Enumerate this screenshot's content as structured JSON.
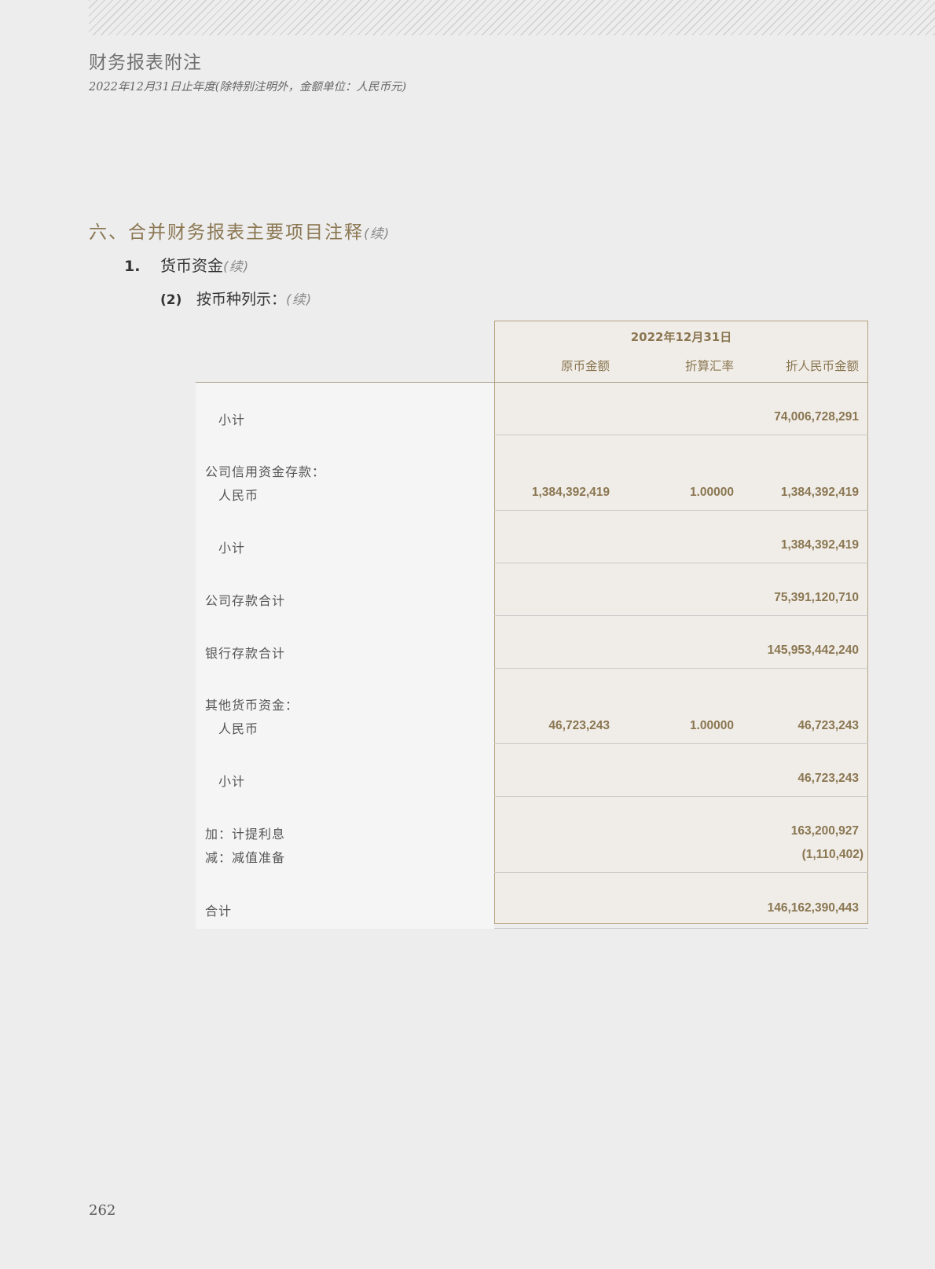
{
  "header": {
    "title": "财务报表附注",
    "subtitle": "2022年12月31日止年度(除特别注明外，金额单位：人民币元)"
  },
  "section": {
    "title": "六、合并财务报表主要项目注释",
    "cont": "(续)"
  },
  "subsection1": {
    "num": "1.",
    "title": "货币资金",
    "cont": "(续)"
  },
  "subsection2": {
    "num": "(2)",
    "title": "按币种列示：",
    "cont": "(续)"
  },
  "table": {
    "date_header": "2022年12月31日",
    "col_original": "原币金额",
    "col_rate": "折算汇率",
    "col_rmb": "折人民币金额",
    "rows": {
      "subtotal1": {
        "label": "小计",
        "rmb": "74,006,728,291"
      },
      "credit_heading": "公司信用资金存款：",
      "credit_rmb": {
        "label": "人民币",
        "orig": "1,384,392,419",
        "rate": "1.00000",
        "rmb": "1,384,392,419"
      },
      "subtotal2": {
        "label": "小计",
        "rmb": "1,384,392,419"
      },
      "company_total": {
        "label": "公司存款合计",
        "rmb": "75,391,120,710"
      },
      "bank_total": {
        "label": "银行存款合计",
        "rmb": "145,953,442,240"
      },
      "other_heading": "其他货币资金：",
      "other_rmb": {
        "label": "人民币",
        "orig": "46,723,243",
        "rate": "1.00000",
        "rmb": "46,723,243"
      },
      "subtotal3": {
        "label": "小计",
        "rmb": "46,723,243"
      },
      "interest": {
        "label": "加：计提利息",
        "rmb": "163,200,927"
      },
      "impairment": {
        "label": "减：减值准备",
        "rmb": "(1,110,402)"
      },
      "total": {
        "label": "合计",
        "rmb": "146,162,390,443"
      }
    }
  },
  "page_number": "262"
}
